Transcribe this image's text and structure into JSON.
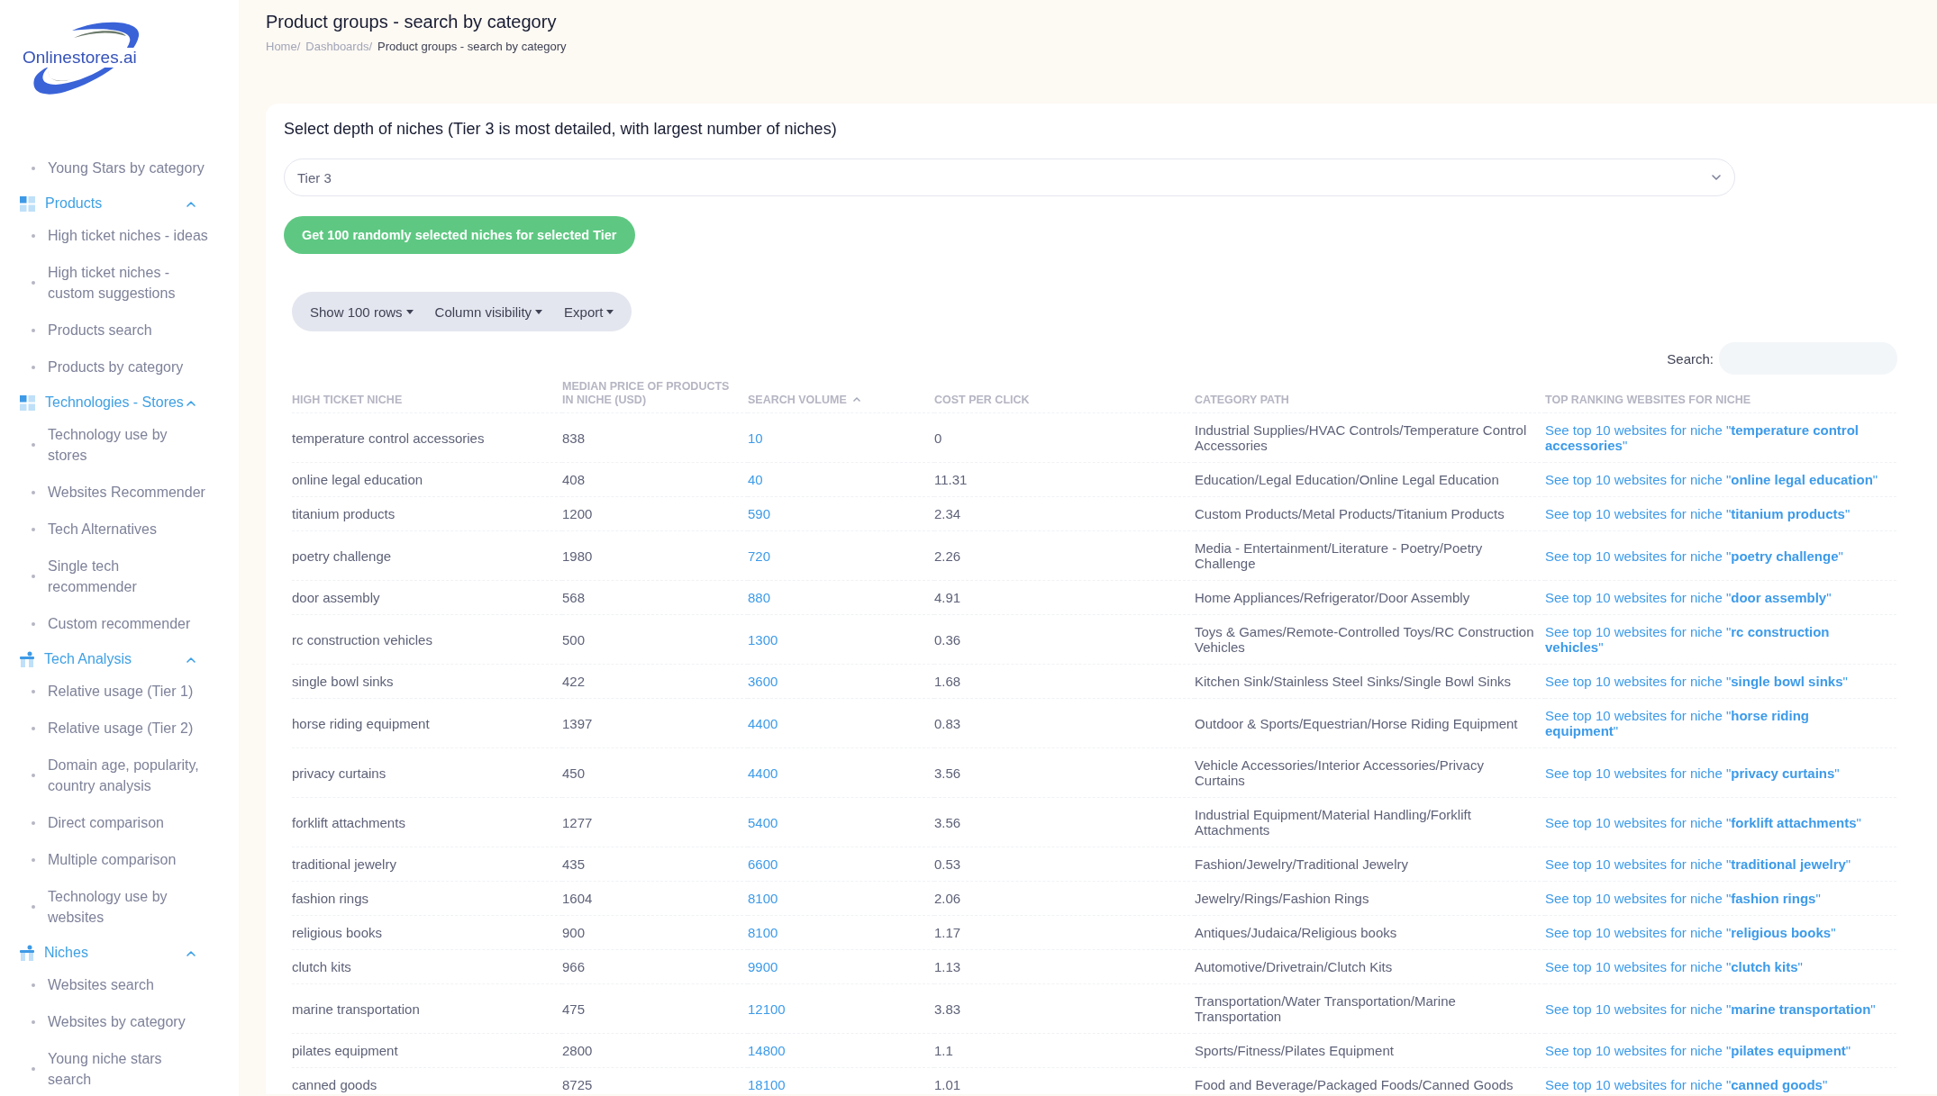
{
  "logo": {
    "text": "Onlinestores.ai"
  },
  "sidebar": {
    "items": [
      {
        "kind": "link",
        "label": "Young Stars by category"
      },
      {
        "kind": "grid-group",
        "label": "Products",
        "expanded": true,
        "children": [
          {
            "label": "High ticket niches - ideas"
          },
          {
            "label": "High ticket niches - custom suggestions"
          },
          {
            "label": "Products search"
          },
          {
            "label": "Products by category"
          }
        ]
      },
      {
        "kind": "grid-group",
        "label": "Technologies - Stores",
        "expanded": true,
        "children": [
          {
            "label": "Technology use by stores"
          },
          {
            "label": "Websites Recommender"
          },
          {
            "label": "Tech Alternatives"
          },
          {
            "label": "Single tech recommender"
          },
          {
            "label": "Custom recommender"
          }
        ]
      },
      {
        "kind": "figure-group",
        "label": "Tech Analysis",
        "expanded": true,
        "children": [
          {
            "label": "Relative usage (Tier 1)"
          },
          {
            "label": "Relative usage (Tier 2)"
          },
          {
            "label": "Domain age, popularity, country analysis"
          },
          {
            "label": "Direct comparison"
          },
          {
            "label": "Multiple comparison"
          },
          {
            "label": "Technology use by websites"
          }
        ]
      },
      {
        "kind": "figure-group",
        "label": "Niches",
        "expanded": true,
        "children": [
          {
            "label": "Websites search"
          },
          {
            "label": "Websites by category"
          },
          {
            "label": "Young niche stars search"
          }
        ]
      }
    ]
  },
  "page": {
    "title": "Product groups - search by category",
    "breadcrumb": [
      "Home/",
      "Dashboards/",
      "Product groups - search by category"
    ]
  },
  "card": {
    "heading": "Select depth of niches (Tier 3 is most detailed, with largest number of niches)",
    "tier_select": {
      "value": "Tier 3"
    },
    "action_button": "Get 100 randomly selected niches for selected Tier",
    "toolbar": [
      "Show 100 rows",
      "Column visibility",
      "Export"
    ],
    "search": {
      "label": "Search:"
    }
  },
  "table": {
    "columns": [
      {
        "label": "HIGH TICKET NICHE",
        "kind": "text",
        "sorted": false
      },
      {
        "label": "MEDIAN PRICE OF PRODUCTS IN NICHE (USD)",
        "kind": "text",
        "sorted": false
      },
      {
        "label": "SEARCH VOLUME",
        "kind": "link",
        "sorted": true
      },
      {
        "label": "COST PER CLICK",
        "kind": "text",
        "sorted": false
      },
      {
        "label": "CATEGORY PATH",
        "kind": "text",
        "sorted": false
      },
      {
        "label": "TOP RANKING WEBSITES FOR NICHE",
        "kind": "link",
        "sorted": false
      }
    ],
    "rows": [
      [
        "temperature control accessories",
        "838",
        "10",
        "0",
        "Industrial Supplies/HVAC Controls/Temperature Control Accessories",
        "See top 10 websites for niche \"**temperature control accessories**\""
      ],
      [
        "online legal education",
        "408",
        "40",
        "11.31",
        "Education/Legal Education/Online Legal Education",
        "See top 10 websites for niche \"**online legal education**\""
      ],
      [
        "titanium products",
        "1200",
        "590",
        "2.34",
        "Custom Products/Metal Products/Titanium Products",
        "See top 10 websites for niche \"**titanium products**\""
      ],
      [
        "poetry challenge",
        "1980",
        "720",
        "2.26",
        "Media - Entertainment/Literature - Poetry/Poetry Challenge",
        "See top 10 websites for niche \"**poetry challenge**\""
      ],
      [
        "door assembly",
        "568",
        "880",
        "4.91",
        "Home Appliances/Refrigerator/Door Assembly",
        "See top 10 websites for niche \"**door assembly**\""
      ],
      [
        "rc construction vehicles",
        "500",
        "1300",
        "0.36",
        "Toys & Games/Remote-Controlled Toys/RC Construction Vehicles",
        "See top 10 websites for niche \"**rc construction vehicles**\""
      ],
      [
        "single bowl sinks",
        "422",
        "3600",
        "1.68",
        "Kitchen Sink/Stainless Steel Sinks/Single Bowl Sinks",
        "See top 10 websites for niche \"**single bowl sinks**\""
      ],
      [
        "horse riding equipment",
        "1397",
        "4400",
        "0.83",
        "Outdoor & Sports/Equestrian/Horse Riding Equipment",
        "See top 10 websites for niche \"**horse riding equipment**\""
      ],
      [
        "privacy curtains",
        "450",
        "4400",
        "3.56",
        "Vehicle Accessories/Interior Accessories/Privacy Curtains",
        "See top 10 websites for niche \"**privacy curtains**\""
      ],
      [
        "forklift attachments",
        "1277",
        "5400",
        "3.56",
        "Industrial Equipment/Material Handling/Forklift Attachments",
        "See top 10 websites for niche \"**forklift attachments**\""
      ],
      [
        "traditional jewelry",
        "435",
        "6600",
        "0.53",
        "Fashion/Jewelry/Traditional Jewelry",
        "See top 10 websites for niche \"**traditional jewelry**\""
      ],
      [
        "fashion rings",
        "1604",
        "8100",
        "2.06",
        "Jewelry/Rings/Fashion Rings",
        "See top 10 websites for niche \"**fashion rings**\""
      ],
      [
        "religious books",
        "900",
        "8100",
        "1.17",
        "Antiques/Judaica/Religious books",
        "See top 10 websites for niche \"**religious books**\""
      ],
      [
        "clutch kits",
        "966",
        "9900",
        "1.13",
        "Automotive/Drivetrain/Clutch Kits",
        "See top 10 websites for niche \"**clutch kits**\""
      ],
      [
        "marine transportation",
        "475",
        "12100",
        "3.83",
        "Transportation/Water Transportation/Marine Transportation",
        "See top 10 websites for niche \"**marine transportation**\""
      ],
      [
        "pilates equipment",
        "2800",
        "14800",
        "1.1",
        "Sports/Fitness/Pilates Equipment",
        "See top 10 websites for niche \"**pilates equipment**\""
      ],
      [
        "canned goods",
        "8725",
        "18100",
        "1.01",
        "Food and Beverage/Packaged Foods/Canned Goods",
        "See top 10 websites for niche \"**canned goods**\""
      ]
    ]
  }
}
